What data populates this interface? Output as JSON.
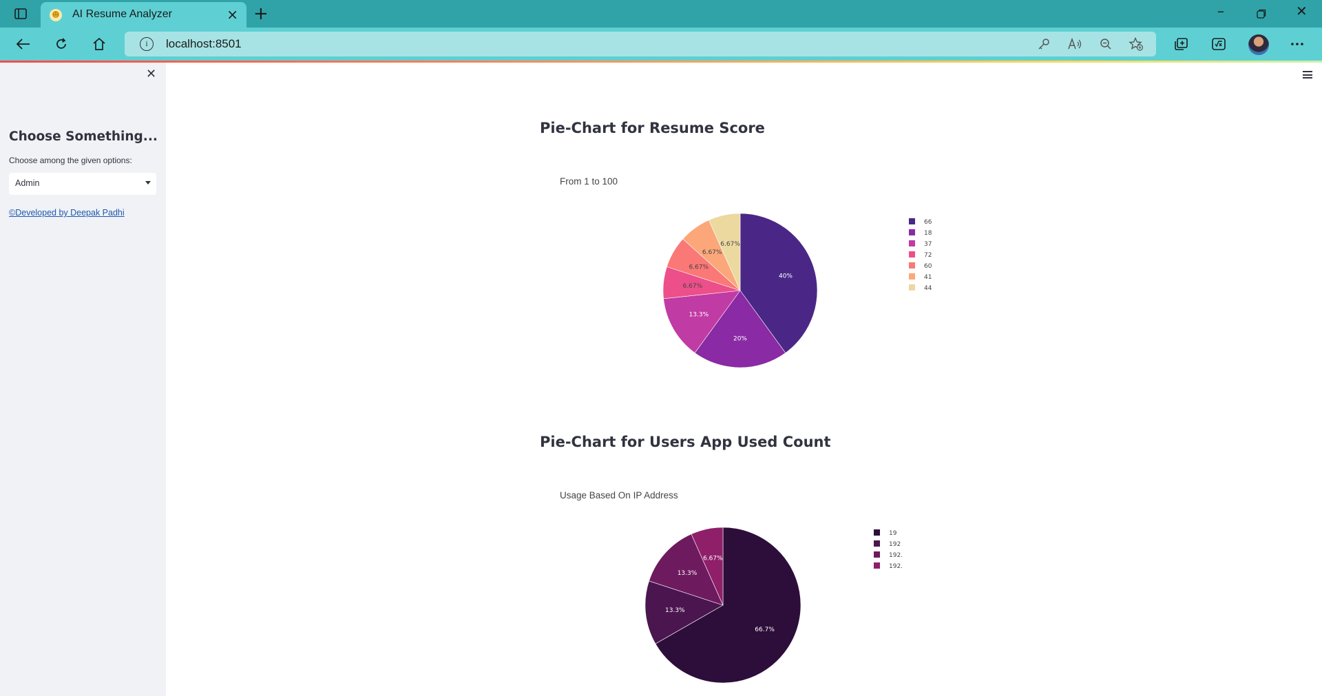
{
  "browser": {
    "tab_title": "AI Resume Analyzer",
    "url": "localhost:8501",
    "icons": [
      "tab-actions-icon",
      "favicon-icon",
      "tab-close-icon",
      "new-tab-icon",
      "minimize-icon",
      "restore-icon",
      "window-close-icon",
      "back-icon",
      "refresh-icon",
      "home-icon",
      "site-info-icon",
      "password-key-icon",
      "read-aloud-icon",
      "zoom-out-icon",
      "add-favorite-icon",
      "collections-icon",
      "math-solver-icon",
      "profile-avatar",
      "more-icon"
    ]
  },
  "sidebar": {
    "heading": "Choose Something...",
    "select_label": "Choose among the given options:",
    "select_value": "Admin",
    "dev_link": "©Developed by Deepak Padhi"
  },
  "main": {
    "score_section_title": "Pie-Chart for Resume Score",
    "usage_section_title": "Pie-Chart for Users App Used Count"
  },
  "chart_data": [
    {
      "type": "pie",
      "title": "From 1 to 100",
      "labels": [
        "66",
        "18",
        "37",
        "72",
        "60",
        "41",
        "44"
      ],
      "values": [
        40,
        20,
        13.3,
        6.67,
        6.67,
        6.67,
        6.67
      ],
      "slice_labels": [
        "40%",
        "20%",
        "13.3%",
        "6.67%",
        "6.67%",
        "6.67%",
        "6.67%"
      ],
      "colors": [
        "#4a2787",
        "#8a2aa4",
        "#c13ba5",
        "#ec4f8a",
        "#fa7876",
        "#fba77a",
        "#ecd9a0"
      ],
      "label_colors": [
        "#ffffff",
        "#ffffff",
        "#ffffff",
        "#444444",
        "#444444",
        "#444444",
        "#444444"
      ],
      "legend": "right"
    },
    {
      "type": "pie",
      "title": "Usage Based On IP Address",
      "labels": [
        "19",
        "192",
        "192.",
        "192."
      ],
      "values": [
        66.7,
        13.3,
        13.3,
        6.67
      ],
      "slice_labels": [
        "66.7%",
        "13.3%",
        "13.3%",
        "6.67%"
      ],
      "colors": [
        "#2d0e3a",
        "#4b1650",
        "#6e1a5e",
        "#901f6a"
      ],
      "label_colors": [
        "#ffffff",
        "#ffffff",
        "#ffffff",
        "#ffffff"
      ],
      "legend": "right"
    }
  ]
}
